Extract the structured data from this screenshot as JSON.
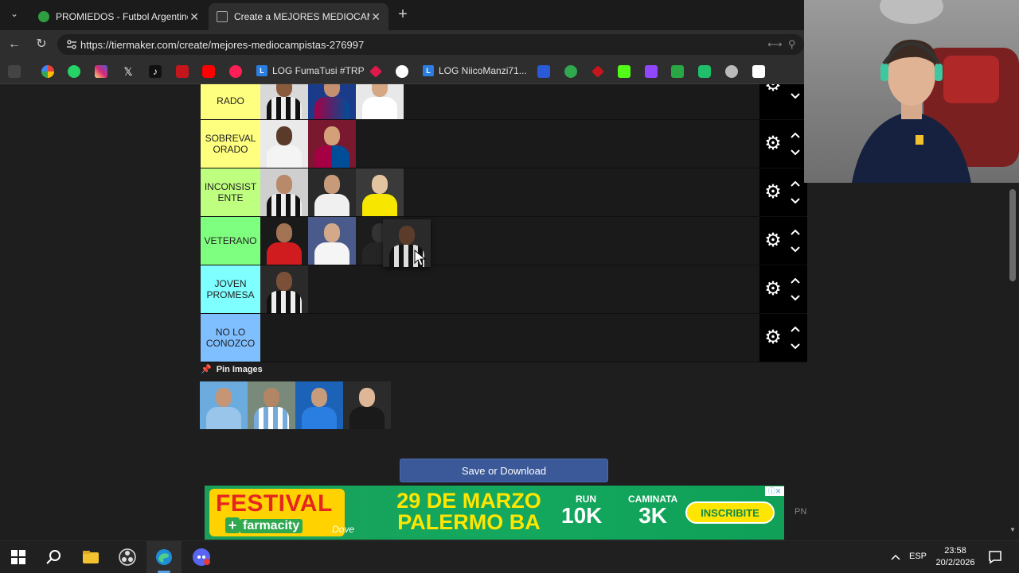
{
  "tabs": [
    {
      "title": "PROMIEDOS - Futbol Argentino - R",
      "active": false
    },
    {
      "title": "Create a MEJORES MEDIOCAMPIS",
      "active": true
    }
  ],
  "address": {
    "url": "https://tiermaker.com/create/mejores-mediocampistas-276997"
  },
  "bookmarks": [
    {
      "label": "LOG FumaTusi #TRP"
    },
    {
      "label": "LOG NiicoManzi71..."
    }
  ],
  "tiers": [
    {
      "label": "RADO",
      "color": "#ffff7f",
      "items": 3
    },
    {
      "label": "SOBREVAL ORADO",
      "color": "#ffff7f",
      "items": 2
    },
    {
      "label": "INCONSIST ENTE",
      "color": "#bfff7f",
      "items": 3
    },
    {
      "label": "VETERANO",
      "color": "#7fff7f",
      "items": 4
    },
    {
      "label": "JOVEN PROMESA",
      "color": "#7fffff",
      "items": 1
    },
    {
      "label": "NO LO CONOZCO",
      "color": "#7fbfff",
      "items": 0
    }
  ],
  "pin": {
    "title": "Pin Images",
    "count": 4
  },
  "save_button": {
    "label": "Save or Download"
  },
  "ad": {
    "festival": "FESTIVAL",
    "brand": "farmacity",
    "partner": "Dove",
    "date_line1": "29 DE MARZO",
    "date_line2": "PALERMO BA",
    "run_label": "RUN",
    "run_value": "10K",
    "walk_label": "CAMINATA",
    "walk_value": "3K",
    "cta": "INSCRIBITE",
    "side_text": "PN"
  },
  "taskbar": {
    "language": "ESP",
    "time": "23:58",
    "date": "20/2/2026"
  }
}
